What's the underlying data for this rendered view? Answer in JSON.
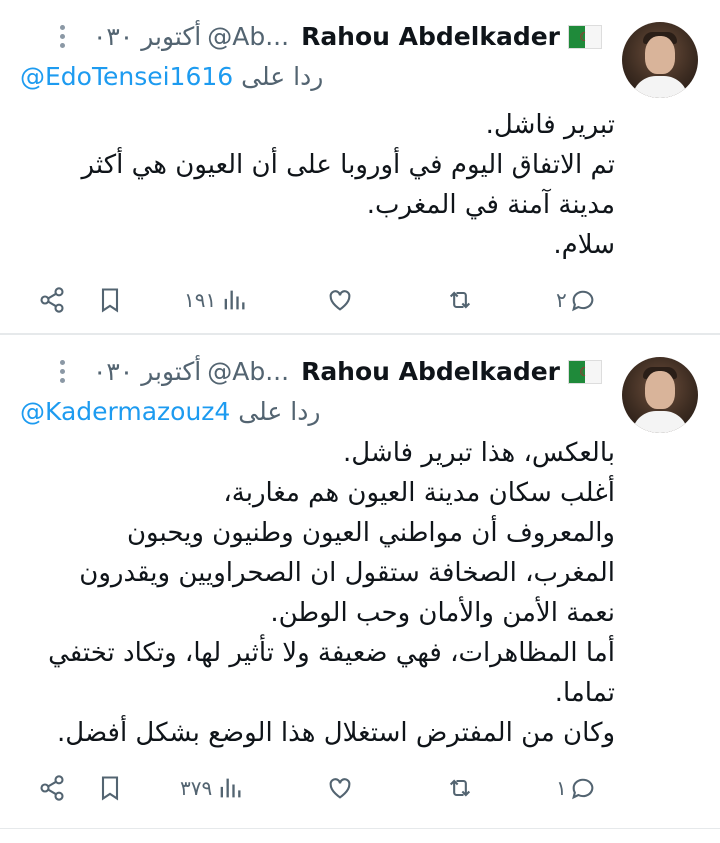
{
  "tweets": [
    {
      "author": {
        "name": "Rahou Abdelkader",
        "handle": "@Ab...",
        "flag": "algeria-flag",
        "avatar": "profile-photo"
      },
      "date": "۰۳۰ أكتوبر",
      "reply_prefix": "ردا على",
      "reply_to": "@EdoTensei1616",
      "lines": [
        "تبرير فاشل.",
        "تم الاتفاق اليوم في أوروبا على أن العيون هي أكثر",
        "مدينة آمنة في المغرب.",
        "سلام."
      ],
      "stats": {
        "replies": "۲",
        "views": "۱۹۱"
      }
    },
    {
      "author": {
        "name": "Rahou Abdelkader",
        "handle": "@Ab...",
        "flag": "algeria-flag",
        "avatar": "profile-photo"
      },
      "date": "۰۳۰ أكتوبر",
      "reply_prefix": "ردا على",
      "reply_to": "@Kadermazouz4",
      "lines": [
        "بالعكس، هذا تبرير فاشل.",
        "أغلب سكان مدينة العيون هم مغاربة،",
        "والمعروف أن مواطني العيون وطنيون ويحبون",
        "المغرب، الصخافة ستقول ان الصحراويين ويقدرون",
        "نعمة الأمن والأمان وحب الوطن.",
        "أما المظاهرات، فهي ضعيفة ولا تأثير لها، وتكاد تختفي",
        "تماما.",
        "وكان من المفترض استغلال هذا الوضع بشكل أفضل."
      ],
      "stats": {
        "replies": "۱",
        "views": "۳۷۹"
      }
    }
  ],
  "icons": [
    "share-icon",
    "bookmark-icon",
    "views-icon",
    "like-icon",
    "retweet-icon",
    "reply-icon",
    "more-icon"
  ],
  "colors": {
    "link": "#1d9bf0",
    "muted": "#536471",
    "text": "#0f1419"
  }
}
